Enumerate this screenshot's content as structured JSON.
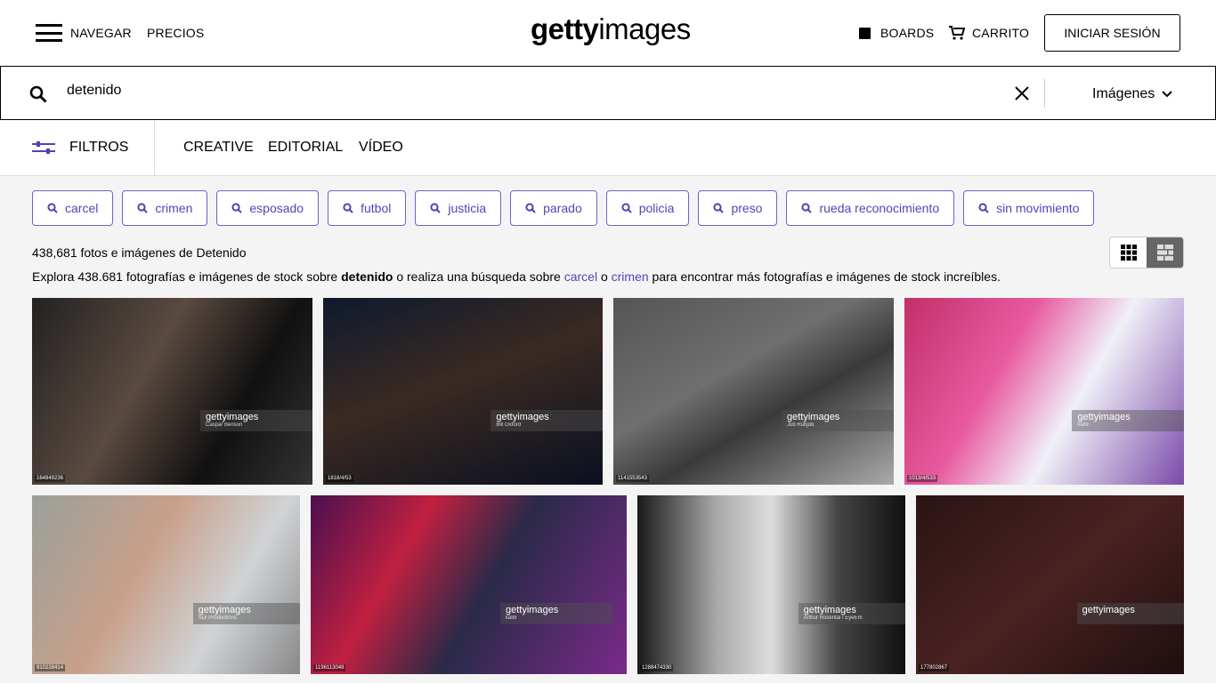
{
  "header": {
    "nav_label": "NAVEGAR",
    "prices_label": "PRECIOS",
    "logo_bold": "getty",
    "logo_light": "images",
    "boards_label": "BOARDS",
    "cart_label": "CARRITO",
    "signin_label": "INICIAR SESIÓN"
  },
  "search": {
    "value": "detenido",
    "type_label": "Imágenes"
  },
  "filters": {
    "label": "FILTROS",
    "tabs": [
      "CREATIVE",
      "EDITORIAL",
      "VÍDEO"
    ]
  },
  "chips": [
    "carcel",
    "crimen",
    "esposado",
    "futbol",
    "justicia",
    "parado",
    "policia",
    "preso",
    "rueda reconocimiento",
    "sin movimiento"
  ],
  "results": {
    "count_text": "438,681 fotos e imágenes de Detenido",
    "desc_pre": "Explora 438.681 fotografías e imágenes de stock sobre ",
    "desc_bold": "detenido",
    "desc_mid": " o realiza una búsqueda sobre ",
    "link1": "carcel",
    "desc_or": " o ",
    "link2": "crimen",
    "desc_post": " para encontrar más fotografías e imágenes de stock increíbles."
  },
  "accent": "#5a3fb5",
  "images": [
    {
      "id": "164849236",
      "credit": "Caspar Benson",
      "bg": "linear-gradient(120deg,#222,#5a4a40 40%,#111 70%,#333)"
    },
    {
      "id": "1818/4/53",
      "credit": "Bill Oxford",
      "bg": "linear-gradient(160deg,#0e1a2e,#3a2a22 45%,#0a1020)"
    },
    {
      "id": "1141553543",
      "credit": "Jub Rubjob",
      "bg": "linear-gradient(150deg,#555,#6f6f6f 40%,#3a3a3a 60%,#aaa)"
    },
    {
      "id": "1013/4/533",
      "credit": "kali9",
      "bg": "linear-gradient(120deg,#c0306a,#e85aa0 35%,#f0f0f8 60%,#7a4aa8)"
    },
    {
      "id": "910228414",
      "credit": "SDI Productions",
      "bg": "linear-gradient(120deg,#9aa09a,#c8a08a 40%,#d0d3d6 70%,#888)"
    },
    {
      "id": "1196113048",
      "credit": "kali9",
      "bg": "linear-gradient(120deg,#4a1050,#c02040 30%,#2a2a48 55%,#7a2a8a)"
    },
    {
      "id": "1288474330",
      "credit": "Arthur Rosental / EyeEm",
      "bg": "linear-gradient(90deg,#1a1a1a,#aaa 30%,#ddd 50%,#444 75%,#111)"
    },
    {
      "id": "177802867",
      "credit": "",
      "bg": "linear-gradient(140deg,#2a1414,#4a2222 50%,#1e0e0e)"
    }
  ]
}
